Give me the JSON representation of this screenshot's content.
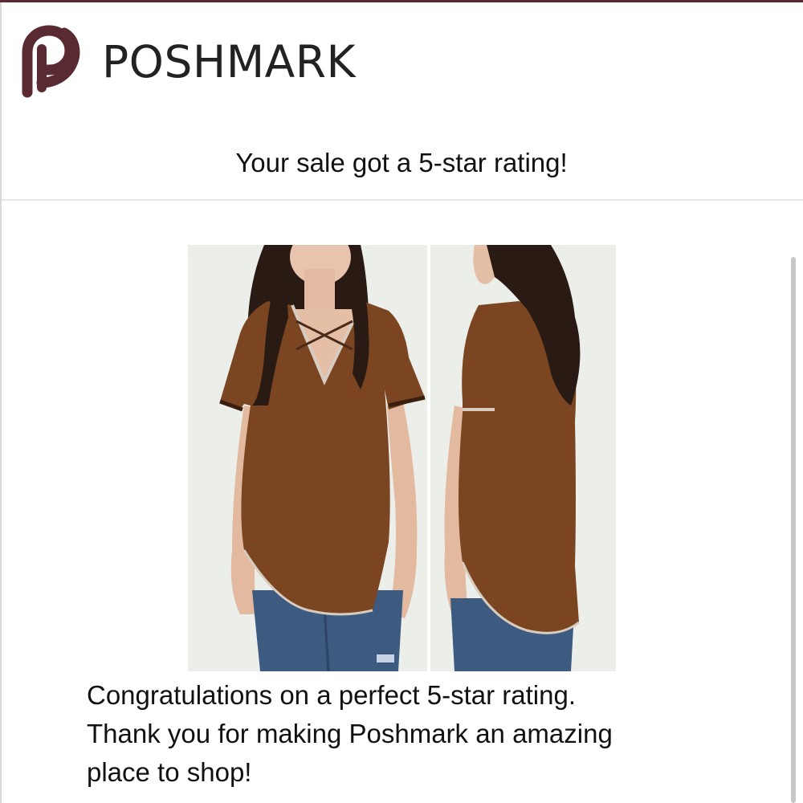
{
  "header": {
    "logo": {
      "icon": "poshmark-logo-icon",
      "brand_text": "POSHMARK",
      "color": "#5a2a32"
    },
    "headline": "Your sale got a 5-star rating!"
  },
  "product_images": [
    {
      "name": "front-view",
      "icon": "model-wearing-top-front"
    },
    {
      "name": "back-view",
      "icon": "model-wearing-top-back"
    }
  ],
  "message": {
    "lines": [
      "Congratulations on a perfect 5-star rating.",
      "Thank you for making Poshmark an amazing",
      "place to shop!"
    ]
  },
  "colors": {
    "accent": "#5a2a32",
    "text": "#111111",
    "top_fabric": "#7a4520"
  }
}
